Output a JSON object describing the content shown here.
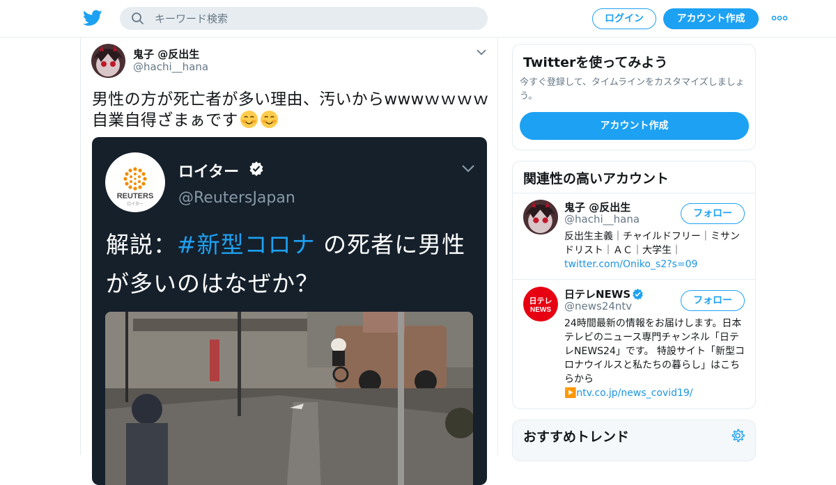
{
  "topbar": {
    "logo_icon": "twitter-bird-icon",
    "search_placeholder": "キーワード検索",
    "login_label": "ログイン",
    "signup_label": "アカウント作成",
    "more_icon": "more-dots-icon",
    "brand_color": "#1da1f2"
  },
  "tweet": {
    "author_name": "鬼子 @反出生",
    "author_handle": "@hachi__hana",
    "text_line1": "男性の方が死亡者が多い理由、汚いからwwwｗｗｗｗ",
    "text_line2": "自業自得ざまぁです",
    "emoji_icons": [
      "smiling-face-icon",
      "smiling-face-icon"
    ],
    "media": {
      "account_name": "ロイター",
      "account_handle": "@ReutersJapan",
      "logo_text": "REUTERS",
      "logo_subtext": "ロイター",
      "headline_prefix": "解説：",
      "headline_hashtag": "#新型コロナ",
      "headline_rest1": " の死者に男性",
      "headline_line2": "が多いのはなぜか？",
      "background_color": "#15202b"
    }
  },
  "sidebar": {
    "signup_card": {
      "title": "Twitterを使ってみよう",
      "description": "今すぐ登録して、タイムラインをカスタマイズしましょう。",
      "button_label": "アカウント作成"
    },
    "related_accounts": {
      "title": "関連性の高いアカウント",
      "items": [
        {
          "name": "鬼子 @反出生",
          "handle": "@hachi__hana",
          "bio": "反出生主義｜チャイルドフリー｜ミサンドリスト｜ＡＣ｜大学生｜",
          "bio_link": "twitter.com/Oniko_s2?s=09",
          "follow_label": "フォロー",
          "verified": false
        },
        {
          "name": "日テレNEWS",
          "handle": "@news24ntv",
          "bio": "24時間最新の情報をお届けします。日本テレビのニュース専門チャンネル「日テレNEWS24」です。 特設サイト「新型コロナウイルスと私たちの暮らし」はこちらから",
          "bio_link": "▶️ntv.co.jp/news_covid19/",
          "follow_label": "フォロー",
          "verified": true,
          "avatar_text_1": "日テレ",
          "avatar_text_2": "NEWS"
        }
      ]
    },
    "trends": {
      "title": "おすすめトレンド",
      "settings_icon": "gear-icon"
    }
  }
}
